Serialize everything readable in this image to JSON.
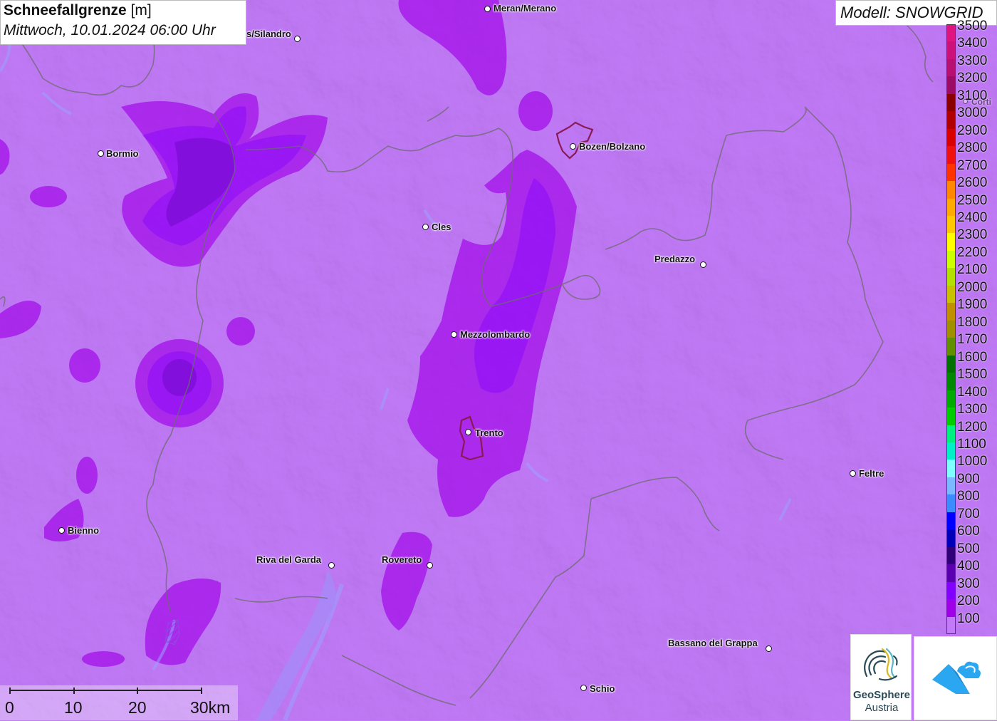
{
  "title": {
    "parameter": "Schneefallgrenze",
    "unit": "[m]",
    "datetime": "Mittwoch, 10.01.2024 06:00 Uhr"
  },
  "model_label": "Modell: SNOWGRID",
  "legend": {
    "levels": [
      {
        "label": "3500",
        "color": "#e0147e"
      },
      {
        "label": "3400",
        "color": "#cc127a"
      },
      {
        "label": "3300",
        "color": "#b80f72"
      },
      {
        "label": "3200",
        "color": "#9c0c66"
      },
      {
        "label": "3100",
        "color": "#8a0000"
      },
      {
        "label": "3000",
        "color": "#b00000"
      },
      {
        "label": "2900",
        "color": "#d80000"
      },
      {
        "label": "2800",
        "color": "#f01010"
      },
      {
        "label": "2700",
        "color": "#ff3300"
      },
      {
        "label": "2600",
        "color": "#ff8800"
      },
      {
        "label": "2500",
        "color": "#ffaa00"
      },
      {
        "label": "2400",
        "color": "#ffc800"
      },
      {
        "label": "2300",
        "color": "#ffff00"
      },
      {
        "label": "2200",
        "color": "#ccff00"
      },
      {
        "label": "2100",
        "color": "#b4e000"
      },
      {
        "label": "2000",
        "color": "#c8c000"
      },
      {
        "label": "1900",
        "color": "#c09000"
      },
      {
        "label": "1800",
        "color": "#a09000"
      },
      {
        "label": "1700",
        "color": "#609000"
      },
      {
        "label": "1600",
        "color": "#007000"
      },
      {
        "label": "1500",
        "color": "#008800"
      },
      {
        "label": "1400",
        "color": "#00aa00"
      },
      {
        "label": "1300",
        "color": "#00cc00"
      },
      {
        "label": "1200",
        "color": "#00f080"
      },
      {
        "label": "1100",
        "color": "#00f0c8"
      },
      {
        "label": "1000",
        "color": "#80ffff"
      },
      {
        "label": "900",
        "color": "#7ab8ff"
      },
      {
        "label": "800",
        "color": "#3a8cff"
      },
      {
        "label": "700",
        "color": "#0000ff"
      },
      {
        "label": "600",
        "color": "#0000b8"
      },
      {
        "label": "500",
        "color": "#30007a"
      },
      {
        "label": "400",
        "color": "#5a00b0"
      },
      {
        "label": "300",
        "color": "#8200ff"
      },
      {
        "label": "200",
        "color": "#a000e8"
      },
      {
        "label": "100",
        "color": "#c27af8"
      }
    ]
  },
  "cities": [
    {
      "name": "Meran/Merano",
      "key": "meran"
    },
    {
      "name": "s/Silandro",
      "key": "silandro"
    },
    {
      "name": "Bormio",
      "key": "bormio"
    },
    {
      "name": "Bozen/Bolzano",
      "key": "bozen"
    },
    {
      "name": "Cles",
      "key": "cles"
    },
    {
      "name": "Predazzo",
      "key": "predazzo"
    },
    {
      "name": "Mezzolombardo",
      "key": "mezzolombardo"
    },
    {
      "name": "Trento",
      "key": "trento"
    },
    {
      "name": "Feltre",
      "key": "feltre"
    },
    {
      "name": "Bienno",
      "key": "bienno"
    },
    {
      "name": "Riva del Garda",
      "key": "riva"
    },
    {
      "name": "Rovereto",
      "key": "rovereto"
    },
    {
      "name": "Bassano del Grappa",
      "key": "bassano"
    },
    {
      "name": "Schio",
      "key": "schio"
    },
    {
      "name": "Corti",
      "key": "cortina"
    }
  ],
  "scalebar": {
    "labels": [
      "0",
      "10",
      "20",
      "30km"
    ]
  },
  "logo": {
    "line1": "GeoSphere",
    "line2": "Austria"
  }
}
